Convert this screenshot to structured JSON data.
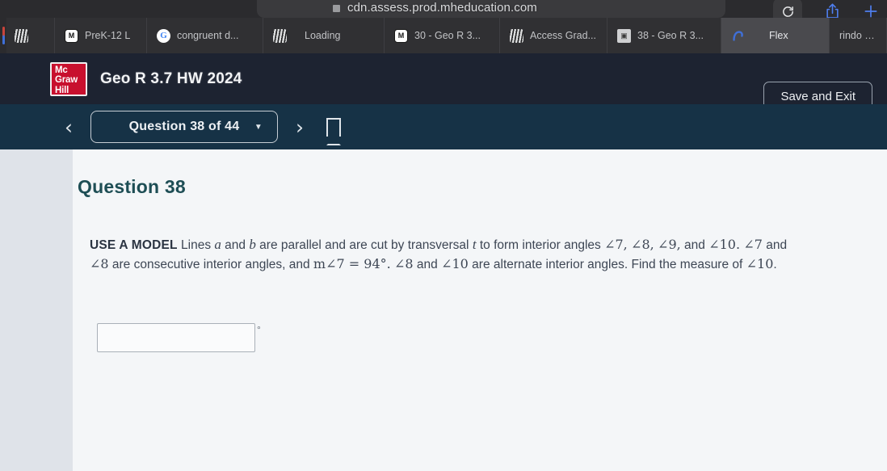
{
  "browser": {
    "url": "cdn.assess.prod.mheducation.com",
    "lock_icon": "lock-icon",
    "actions": [
      {
        "name": "reload-icon",
        "label": "Reload"
      },
      {
        "name": "share-icon",
        "label": "Share"
      },
      {
        "name": "new-tab-icon",
        "label": "New Tab"
      }
    ],
    "tabs": [
      {
        "label": "",
        "icon": "mcgraw-hill-favicon",
        "active": false
      },
      {
        "label": "PreK-12 L",
        "icon": "mheducation-m-favicon",
        "active": false
      },
      {
        "label": "congruent d...",
        "icon": "google-favicon",
        "active": false
      },
      {
        "label": "Loading",
        "icon": "mcgraw-hill-favicon",
        "active": false
      },
      {
        "label": "30 - Geo R 3...",
        "icon": "mheducation-m-favicon",
        "active": false
      },
      {
        "label": "Access Grad...",
        "icon": "mcgraw-hill-favicon",
        "active": false
      },
      {
        "label": "38 - Geo R 3...",
        "icon": "document-favicon",
        "active": false
      },
      {
        "label": "Flex",
        "icon": "flex-favicon",
        "active": true
      },
      {
        "label": "rindo c...",
        "icon": "none",
        "active": false
      }
    ]
  },
  "app_header": {
    "logo_lines": [
      "Mc",
      "Graw",
      "Hill"
    ],
    "logo_color": "#c8102e",
    "title": "Geo R 3.7 HW 2024",
    "save_exit_label": "Save and Exit"
  },
  "question_nav": {
    "prev_label": "‹",
    "next_label": "›",
    "selector_label": "Question 38 of 44",
    "caret": "▼",
    "bookmark_icon": "bookmark-icon"
  },
  "question": {
    "heading": "Question 38",
    "tag": "USE A MODEL",
    "text_part_1": " Lines ",
    "var_a": "a",
    "text_part_2": " and ",
    "var_b": "b",
    "text_part_3": " are parallel and are cut by transversal ",
    "var_t": "t",
    "text_part_4": " to form interior angles ",
    "ang_7a": "∠7,",
    "ang_8a": "∠8,",
    "ang_9a": "∠9,",
    "text_part_5": " and ",
    "ang_10a": "∠10.",
    "ang_7b": "∠7",
    "text_part_6": " and ",
    "ang_8b": "∠8",
    "text_part_7": " are consecutive interior angles, and ",
    "equation": "m∠7 = 94°.",
    "ang_8c": "∠8",
    "text_part_8": " and ",
    "ang_10b": "∠10",
    "text_part_9": " are alternate interior angles. Find the measure of ",
    "ang_10c": "∠10",
    "text_part_10": ".",
    "answer_value": "",
    "answer_placeholder": "",
    "answer_unit": "°"
  }
}
